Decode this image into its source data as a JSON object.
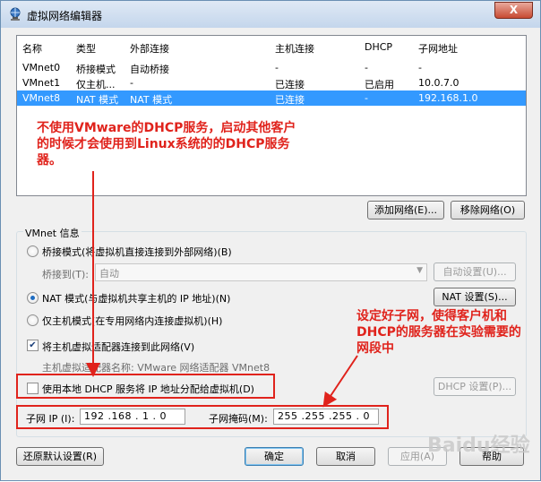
{
  "window": {
    "title": "虚拟网络编辑器",
    "close_label": "X"
  },
  "table": {
    "headers": [
      "名称",
      "类型",
      "外部连接",
      "主机连接",
      "DHCP",
      "子网地址"
    ],
    "rows": [
      [
        "VMnet0",
        "桥接模式",
        "自动桥接",
        "-",
        "-",
        "-"
      ],
      [
        "VMnet1",
        "仅主机...",
        "-",
        "已连接",
        "已启用",
        "10.0.7.0"
      ],
      [
        "VMnet8",
        "NAT 模式",
        "NAT 模式",
        "已连接",
        "-",
        "192.168.1.0"
      ]
    ],
    "selected_row": 2
  },
  "buttons": {
    "add_network": "添加网络(E)...",
    "remove_network": "移除网络(O)",
    "auto_settings": "自动设置(U)...",
    "nat_settings": "NAT 设置(S)...",
    "dhcp_settings": "DHCP 设置(P)...",
    "restore_defaults": "还原默认设置(R)",
    "ok": "确定",
    "cancel": "取消",
    "apply": "应用(A)",
    "help": "帮助"
  },
  "vmnet_info": {
    "group_label": "VMnet 信息",
    "bridge_radio": "桥接模式(将虚拟机直接连接到外部网络)(B)",
    "bridge_to_label": "桥接到(T):",
    "bridge_to_value": "自动",
    "nat_radio": "NAT 模式(与虚拟机共享主机的 IP 地址)(N)",
    "hostonly_radio": "仅主机模式(在专用网络内连接虚拟机)(H)",
    "connect_adapter_check": "将主机虚拟适配器连接到此网络(V)",
    "adapter_name": "主机虚拟适配器名称: VMware 网络适配器 VMnet8",
    "use_dhcp_check": "使用本地 DHCP 服务将 IP 地址分配给虚拟机(D)",
    "subnet_ip_label": "子网 IP (I):",
    "subnet_ip_value": "192 .168 . 1 . 0",
    "subnet_mask_label": "子网掩码(M):",
    "subnet_mask_value": "255 .255 .255 . 0",
    "selected_mode": "nat",
    "connect_adapter_checked": true,
    "use_dhcp_checked": false
  },
  "annotations": {
    "note1": "不使用VMware的DHCP服务，启动其他客户的时候才会使用到Linux系统的的DHCP服务器。",
    "note2": "设定好子网，使得客户机和DHCP的服务器在实验需要的网段中",
    "color": "#e0231c"
  },
  "watermark": "Baidu经验"
}
